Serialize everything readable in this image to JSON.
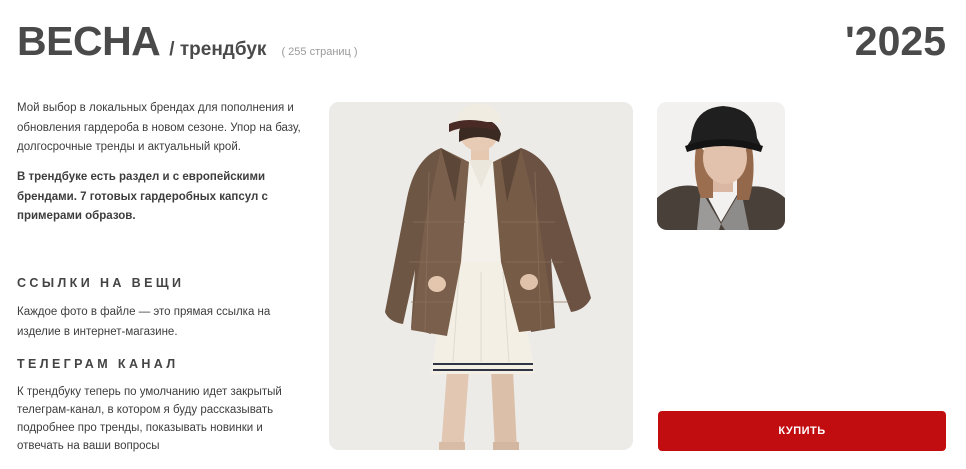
{
  "header": {
    "title": "ВЕСНА",
    "subtitle": "/ трендбук",
    "pages": "( 255 страниц )",
    "year": "'2025"
  },
  "intro": {
    "text": "Мой выбор в локальных брендах для пополнения и обновления гардероба в новом сезоне. Упор на базу, долгосрочные тренды и актуальный крой.",
    "bold_text": "В трендбуке есть раздел и с европейскими брендами. 7 готовых гардеробных капсул с примерами образов."
  },
  "links_section": {
    "heading": "ССЫЛКИ НА ВЕЩИ",
    "text": "Каждое фото в файле — это прямая ссылка на изделие в интернет-магазине."
  },
  "telegram_section": {
    "heading": "ТЕЛЕГРАМ КАНАЛ",
    "text": "К трендбуку теперь по умолчанию идет закрытый телеграм-канал, в котором я буду рассказывать подробнее про тренды, показывать новинки и отвечать на ваши вопросы"
  },
  "buy_button": {
    "label": "КУПИТЬ",
    "color": "#c10c10"
  },
  "images": {
    "main_photo": "fashion-photo-plaid-blazer",
    "side_photo": "fashion-photo-black-hat"
  }
}
